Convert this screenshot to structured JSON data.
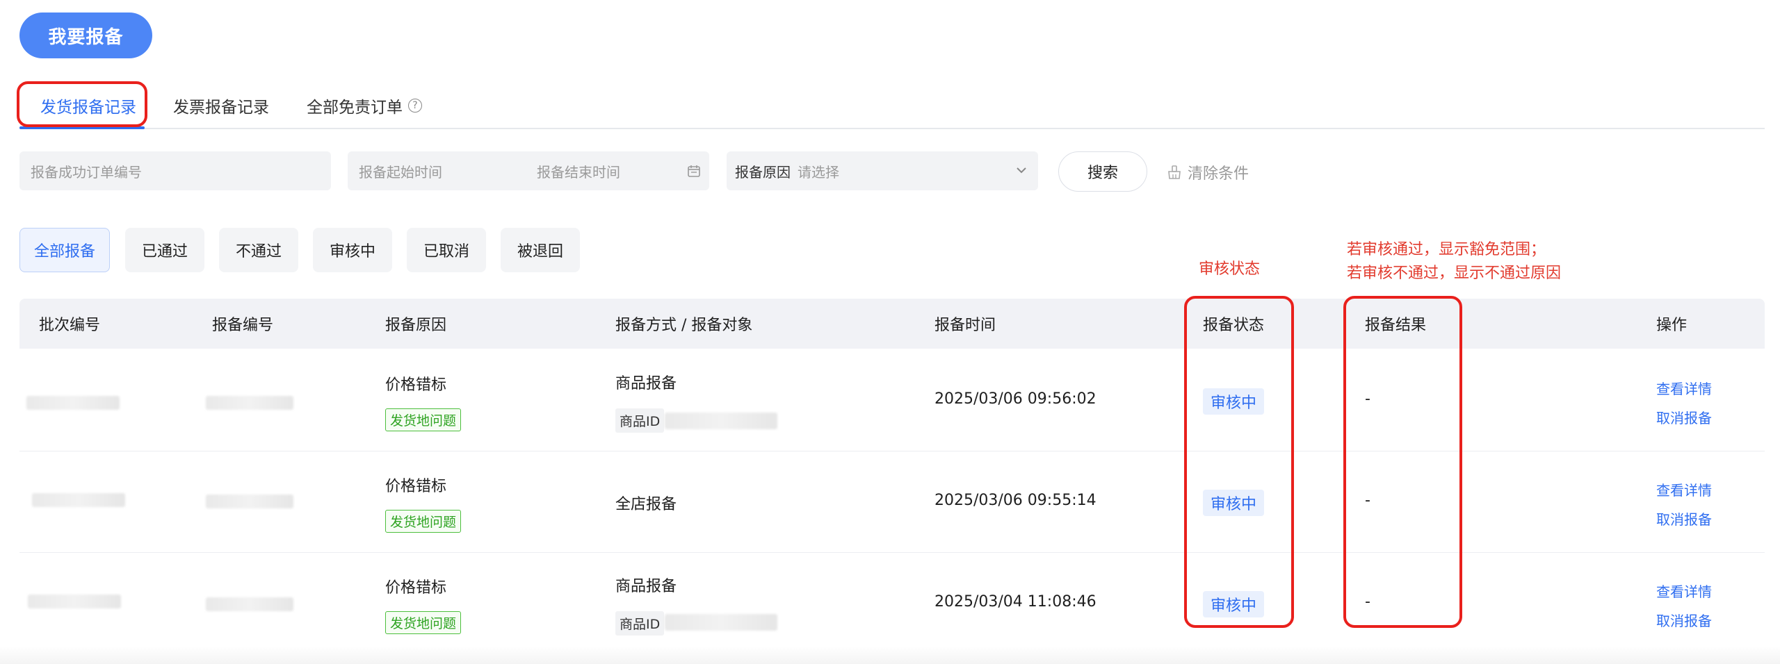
{
  "primary_action": "我要报备",
  "tabs": [
    {
      "label": "发货报备记录",
      "active": true
    },
    {
      "label": "发票报备记录",
      "active": false
    },
    {
      "label": "全部免责订单",
      "active": false
    }
  ],
  "search": {
    "order_placeholder": "报备成功订单编号",
    "start_time_placeholder": "报备起始时间",
    "end_time_placeholder": "报备结束时间",
    "reason_label": "报备原因",
    "reason_placeholder": "请选择",
    "search_button": "搜索",
    "clear_button": "清除条件"
  },
  "filters": [
    "全部报备",
    "已通过",
    "不通过",
    "审核中",
    "已取消",
    "被退回"
  ],
  "annotations": {
    "status_note": "审核状态",
    "result_note_line1": "若审核通过，显示豁免范围；",
    "result_note_line2": "若审核不通过，显示不通过原因"
  },
  "table": {
    "headers": [
      "批次编号",
      "报备编号",
      "报备原因",
      "报备方式 / 报备对象",
      "报备时间",
      "报备状态",
      "报备结果",
      "操作"
    ],
    "rows": [
      {
        "reason": "价格错标",
        "reason_tag": "发货地问题",
        "method": "商品报备",
        "object_label": "商品ID",
        "time": "2025/03/06 09:56:02",
        "status": "审核中",
        "result": "-",
        "action_view": "查看详情",
        "action_cancel": "取消报备"
      },
      {
        "reason": "价格错标",
        "reason_tag": "发货地问题",
        "method": "全店报备",
        "object_label": "",
        "time": "2025/03/06 09:55:14",
        "status": "审核中",
        "result": "-",
        "action_view": "查看详情",
        "action_cancel": "取消报备"
      },
      {
        "reason": "价格错标",
        "reason_tag": "发货地问题",
        "method": "商品报备",
        "object_label": "商品ID",
        "time": "2025/03/04 11:08:46",
        "status": "审核中",
        "result": "-",
        "action_view": "查看详情",
        "action_cancel": "取消报备"
      }
    ]
  },
  "colors": {
    "primary": "#4d86f6",
    "link": "#2f6ef0",
    "annotation": "#e23b2e",
    "tag_green": "#2ea321"
  }
}
